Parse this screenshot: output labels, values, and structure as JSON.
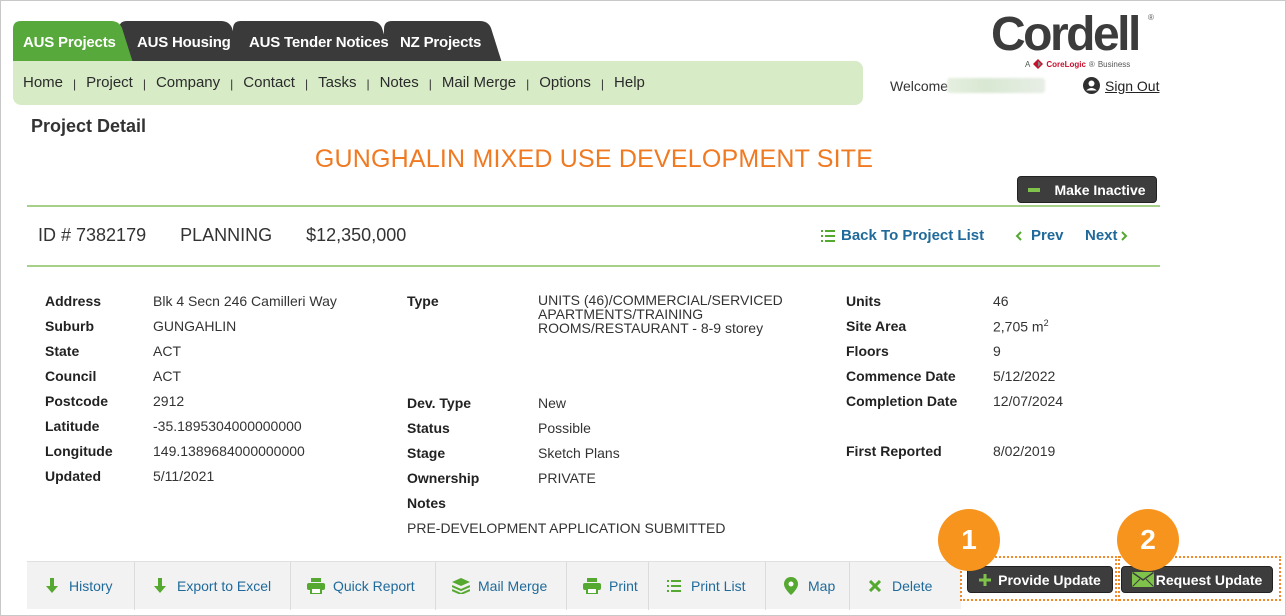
{
  "tabs": [
    {
      "label": "AUS Projects",
      "active": true
    },
    {
      "label": "AUS Housing"
    },
    {
      "label": "AUS Tender Notices"
    },
    {
      "label": "NZ Projects"
    }
  ],
  "nav": {
    "items": [
      "Home",
      "Project",
      "Company",
      "Contact",
      "Tasks",
      "Notes",
      "Mail Merge",
      "Options",
      "Help"
    ],
    "separator": "|"
  },
  "brand": {
    "name": "Cordell",
    "reg": "®",
    "sub_prefix": "A",
    "sub_brand": "CoreLogic",
    "sub_reg": "®",
    "sub_suffix": "Business"
  },
  "user": {
    "welcome": "Welcome",
    "sign_out": "Sign Out"
  },
  "page": {
    "title": "Project Detail",
    "project_name": "GUNGHALIN MIXED USE DEVELOPMENT SITE",
    "make_inactive": "Make Inactive"
  },
  "summary": {
    "id": "ID # 7382179",
    "stage": "PLANNING",
    "value": "$12,350,000",
    "back": "Back To Project List",
    "prev": "Prev",
    "next": "Next"
  },
  "details": {
    "address_label": "Address",
    "address": "Blk 4 Secn 246 Camilleri Way",
    "suburb_label": "Suburb",
    "suburb": "GUNGAHLIN",
    "state_label": "State",
    "state": "ACT",
    "council_label": "Council",
    "council": "ACT",
    "postcode_label": "Postcode",
    "postcode": "2912",
    "latitude_label": "Latitude",
    "latitude": "-35.1895304000000000",
    "longitude_label": "Longitude",
    "longitude": "149.1389684000000000",
    "updated_label": "Updated",
    "updated": "5/11/2021",
    "type_label": "Type",
    "type_line1": "UNITS (46)/COMMERCIAL/SERVICED",
    "type_line2": "APARTMENTS/TRAINING",
    "type_line3": "ROOMS/RESTAURANT - 8-9 storey",
    "devtype_label": "Dev. Type",
    "devtype": "New",
    "status_label": "Status",
    "status": "Possible",
    "stage_label": "Stage",
    "stage": "Sketch Plans",
    "ownership_label": "Ownership",
    "ownership": "PRIVATE",
    "notes_label": "Notes",
    "notes": "PRE-DEVELOPMENT APPLICATION SUBMITTED",
    "units_label": "Units",
    "units": "46",
    "site_area_label": "Site Area",
    "site_area": "2,705 m",
    "site_area_unit_sup": "2",
    "floors_label": "Floors",
    "floors": "9",
    "commence_label": "Commence Date",
    "commence": "5/12/2022",
    "completion_label": "Completion Date",
    "completion": "12/07/2024",
    "first_reported_label": "First Reported",
    "first_reported": "8/02/2019"
  },
  "toolbar": {
    "history": "History",
    "export": "Export to Excel",
    "quick_report": "Quick Report",
    "mail_merge": "Mail Merge",
    "print": "Print",
    "print_list": "Print List",
    "map": "Map",
    "delete": "Delete",
    "provide_update": "Provide Update",
    "request_update": "Request Update"
  },
  "callouts": {
    "one": "1",
    "two": "2"
  },
  "colors": {
    "tab_active": "#56a93a",
    "tab_inactive": "#3a3a3a",
    "nav_bg": "#d6ebc6",
    "accent_orange": "#f07a22",
    "link_blue": "#1f6a9a",
    "icon_green": "#55a830",
    "badge_orange": "#f7941d"
  }
}
